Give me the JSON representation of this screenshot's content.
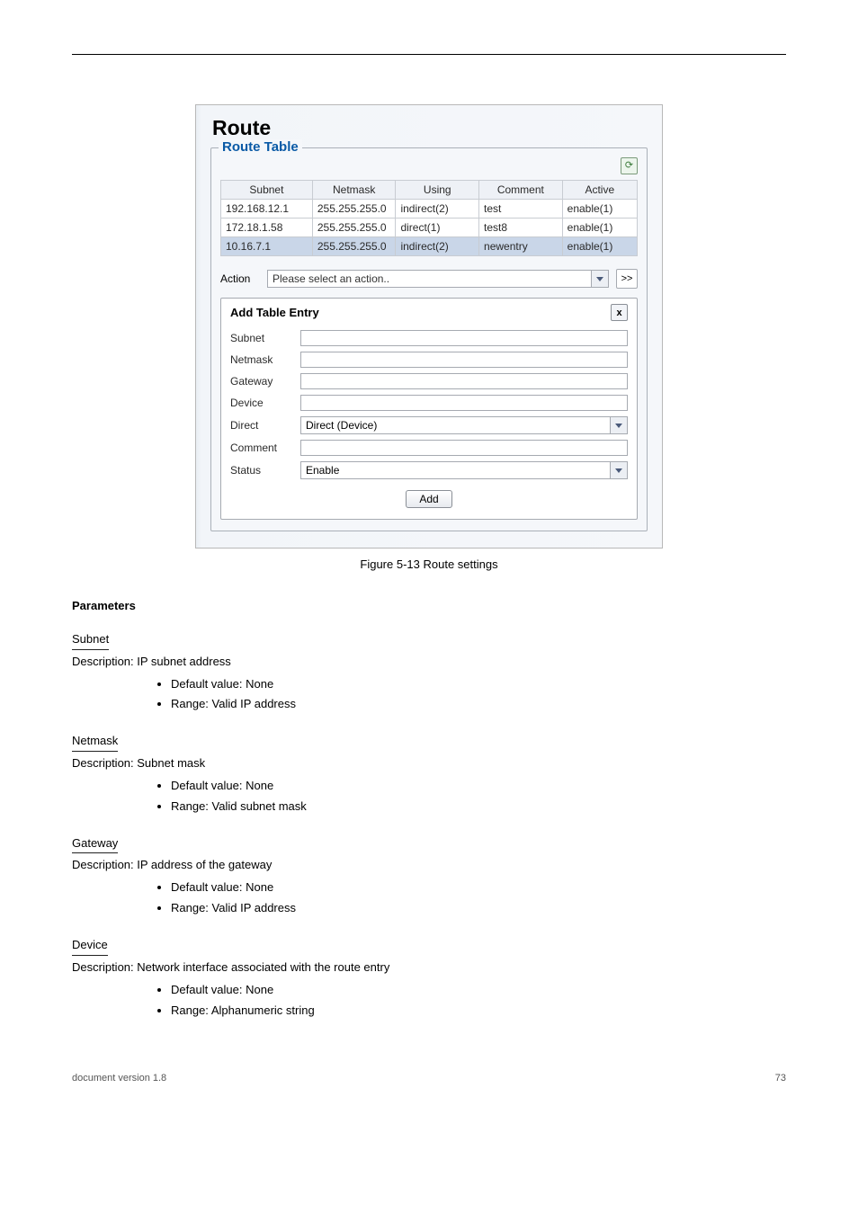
{
  "figure": {
    "title": "Route",
    "fieldset_legend": "Route Table",
    "refresh_icon": "⟳",
    "columns": [
      "Subnet",
      "Netmask",
      "Using",
      "Comment",
      "Active"
    ],
    "rows": [
      {
        "subnet": "192.168.12.1",
        "netmask": "255.255.255.0",
        "using": "indirect(2)",
        "comment": "test",
        "active": "enable(1)"
      },
      {
        "subnet": "172.18.1.58",
        "netmask": "255.255.255.0",
        "using": "direct(1)",
        "comment": "test8",
        "active": "enable(1)"
      },
      {
        "subnet": "10.16.7.1",
        "netmask": "255.255.255.0",
        "using": "indirect(2)",
        "comment": "newentry",
        "active": "enable(1)"
      }
    ],
    "action_label": "Action",
    "action_placeholder": "Please select an action..",
    "go_label": ">>",
    "panel": {
      "title": "Add Table Entry",
      "close": "x",
      "fields": {
        "subnet": "Subnet",
        "netmask": "Netmask",
        "gateway": "Gateway",
        "device": "Device",
        "direct": "Direct",
        "direct_value": "Direct (Device)",
        "comment": "Comment",
        "status": "Status",
        "status_value": "Enable"
      },
      "add_label": "Add"
    }
  },
  "caption": "Figure 5-13 Route settings",
  "desc": {
    "parameters_heading": "Parameters",
    "subnet_term": "Subnet",
    "subnet_sub": "Description: IP subnet address",
    "subnet_b1": "Default value: None",
    "subnet_b2": "Range: Valid IP address",
    "netmask_term": "Netmask",
    "netmask_sub": "Description: Subnet mask",
    "netmask_b1": "Default value: None",
    "netmask_b2": "Range: Valid subnet mask",
    "gateway_term": "Gateway",
    "gateway_sub": "Description: IP address of the gateway",
    "gateway_b1": "Default value: None",
    "gateway_b2": "Range: Valid IP address",
    "device_term": "Device",
    "device_sub": "Description: Network interface associated with the route entry",
    "device_b1": "Default value: None",
    "device_b2": "Range: Alphanumeric string"
  },
  "footer": {
    "left": "document version 1.8",
    "right": "73"
  }
}
